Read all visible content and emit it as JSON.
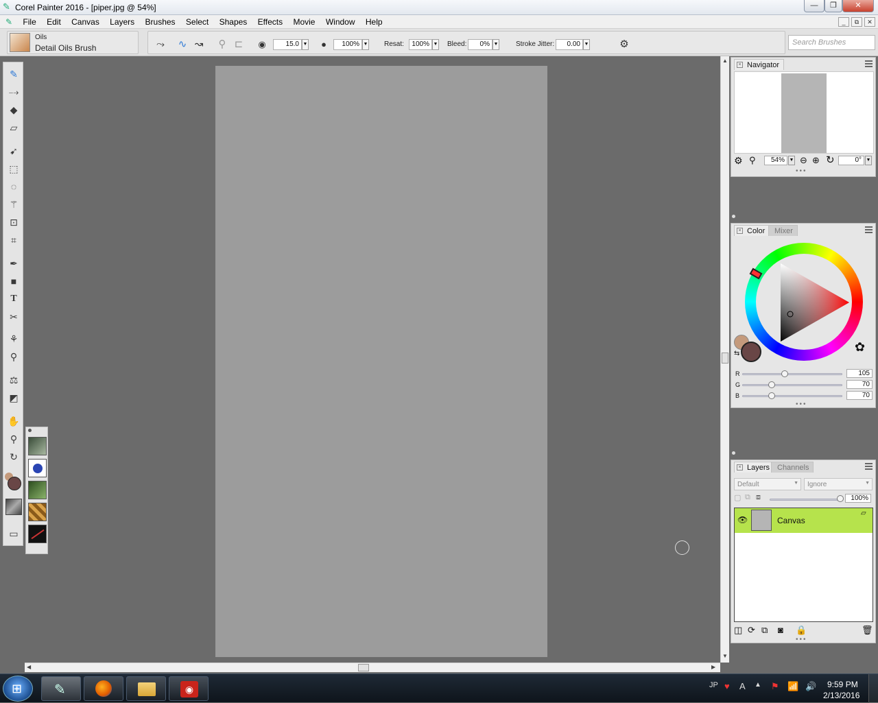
{
  "window": {
    "title": "Corel Painter 2016 - [piper.jpg @ 54%]",
    "minimize": "—",
    "maximize": "❐",
    "close": "✕"
  },
  "menu": [
    "File",
    "Edit",
    "Canvas",
    "Layers",
    "Brushes",
    "Select",
    "Shapes",
    "Effects",
    "Movie",
    "Window",
    "Help"
  ],
  "mdi_controls": [
    "_",
    "⧉",
    "✕"
  ],
  "property_bar": {
    "brush_category": "Oils",
    "brush_variant": "Detail Oils Brush",
    "size_value": "15.0",
    "opacity_value": "100%",
    "resat_label": "Resat:",
    "resat_value": "100%",
    "bleed_label": "Bleed:",
    "bleed_value": "0%",
    "jitter_label": "Stroke Jitter:",
    "jitter_value": "0.00",
    "search_placeholder": "Search Brushes"
  },
  "navigator": {
    "tab": "Navigator",
    "zoom": "54%",
    "rotation": "0°"
  },
  "color_panel": {
    "tab_color": "Color",
    "tab_mixer": "Mixer",
    "r_label": "R",
    "g_label": "G",
    "b_label": "B",
    "r": "105",
    "g": "70",
    "b": "70",
    "main_color": "#694646",
    "additional_color": "#c49a7c"
  },
  "layers_panel": {
    "tab_layers": "Layers",
    "tab_channels": "Channels",
    "composite_method": "Default",
    "preserve": "Ignore",
    "opacity": "100%",
    "layers": [
      {
        "name": "Canvas",
        "visible": true,
        "selected": true
      }
    ]
  },
  "taskbar": {
    "lang": "JP",
    "time": "9:59 PM",
    "date": "2/13/2016"
  }
}
